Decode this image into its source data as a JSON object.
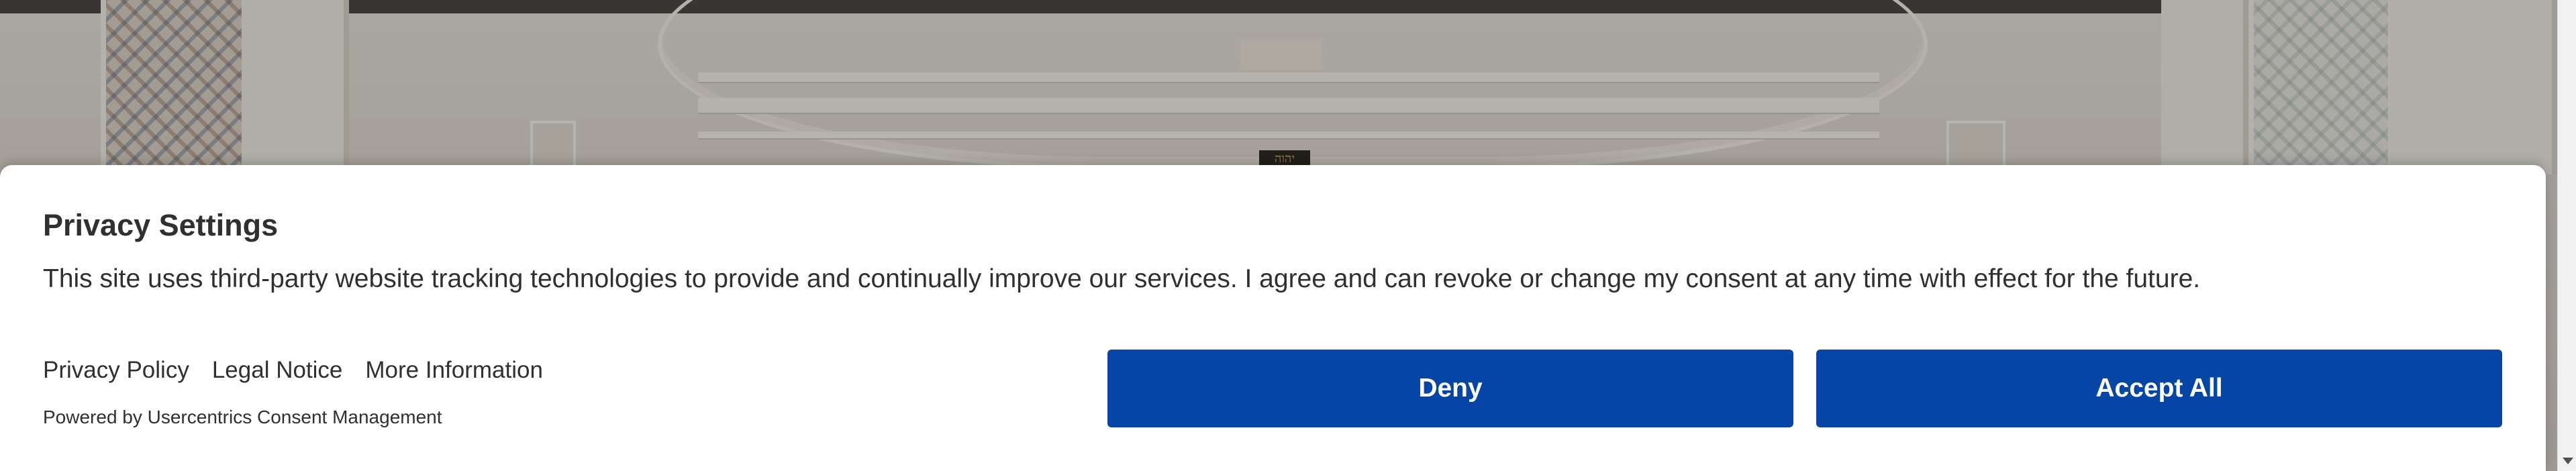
{
  "background": {
    "inscription": "יהוה"
  },
  "consent_banner": {
    "title": "Privacy Settings",
    "description": "This site uses third-party website tracking technologies to provide and continually improve our services. I agree and can revoke or change my consent at any time with effect for the future.",
    "links": {
      "privacy_policy": "Privacy Policy",
      "legal_notice": "Legal Notice",
      "more_information": "More Information"
    },
    "powered_by": "Powered by Usercentrics Consent Management",
    "buttons": {
      "deny": "Deny",
      "accept_all": "Accept All"
    },
    "colors": {
      "button_background": "#0445a6",
      "button_text": "#ffffff",
      "text": "#303030",
      "banner_background": "#ffffff"
    }
  },
  "icons": {
    "scroll_down": "chevron-down-icon"
  }
}
